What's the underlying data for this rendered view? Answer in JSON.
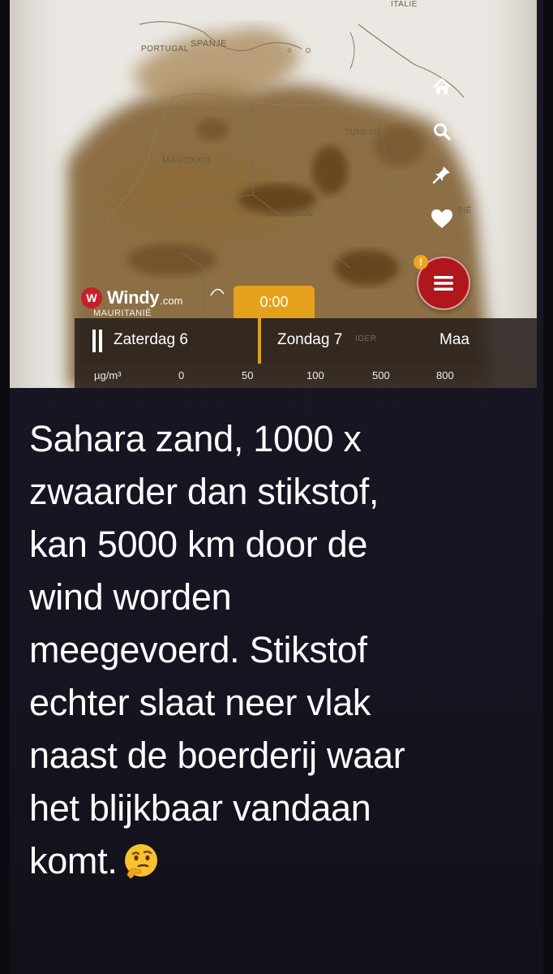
{
  "map": {
    "labels": {
      "portugal": "PORTUGAL",
      "spanje": "SPANJE",
      "italie": "ITALIE",
      "marokko": "MAROKKO",
      "tunesie": "TUNESIË",
      "algerije": "ALGERIJE",
      "libie": "BIË",
      "mauritanie": "MAURITANIË",
      "niger": "IGER"
    },
    "logo": {
      "brand": "Windy",
      "domain": ".com",
      "mark_letter": "W"
    },
    "alert_badge": "!",
    "icons": [
      "home-icon",
      "search-icon",
      "pin-icon",
      "heart-icon",
      "menu-icon"
    ],
    "accent_color": "#e6a11c",
    "menu_color": "#b0161b"
  },
  "timeline": {
    "current_time": "0:00",
    "days": [
      "Zaterdag 6",
      "Zondag 7",
      "Maa"
    ]
  },
  "legend": {
    "unit": "µg/m³",
    "values": [
      "0",
      "50",
      "100",
      "500",
      "800"
    ]
  },
  "caption": {
    "lines": [
      "Sahara zand, 1000 x",
      "zwaarder dan stikstof,",
      "kan 5000 km door de",
      "wind worden",
      "meegevoerd. Stikstof",
      "echter slaat neer vlak",
      "naast de boerderij waar",
      "het blijkbaar vandaan",
      "komt."
    ],
    "emoji": "thinking-face-icon"
  }
}
